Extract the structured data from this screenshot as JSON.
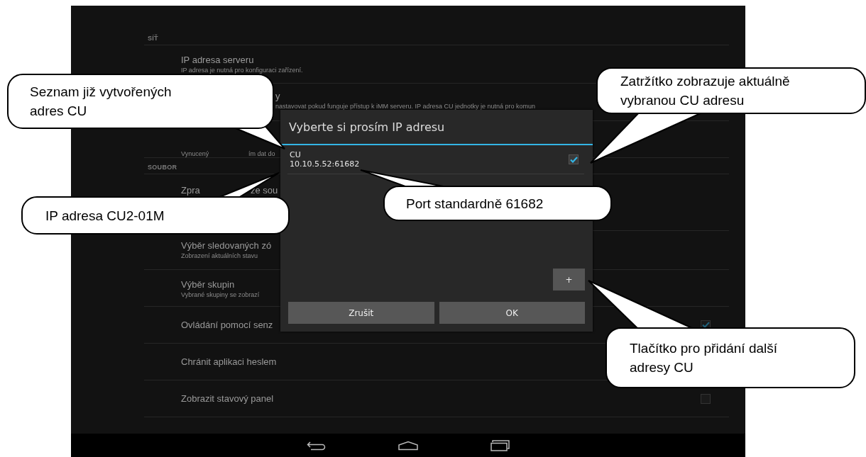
{
  "screen": {
    "sections": [
      {
        "title": "SÍŤ",
        "items": [
          {
            "title": [
              "IP adresa serveru"
            ],
            "subtitle": [
              "IP adresa je nutná pro konfiguraci zařízení."
            ]
          },
          {
            "title": [
              "y"
            ],
            "subtitle": [
              "nastavovat pokud funguje přístup k iMM serveru. IP adresa CU jednotky je nutná pro komun"
            ]
          },
          {
            "subtitle": [
              "Vynucený",
              "ím dat do"
            ]
          }
        ]
      },
      {
        "title": "SOUBOR",
        "items": [
          {
            "title": [
              "Zpra",
              "ze sou"
            ]
          },
          {
            "title": [
              "Výběr sledovaných zó"
            ],
            "subtitle": [
              "Zobrazení aktuálních stavu"
            ]
          },
          {
            "title": [
              "Výběr skupin"
            ],
            "subtitle": [
              "Vybrané skupiny se zobrazí"
            ]
          },
          {
            "title": [
              "Ovládání pomocí senz"
            ],
            "checked": true
          },
          {
            "title": [
              "Chránit aplikaci heslem"
            ]
          },
          {
            "title": [
              "Zobrazit stavový panel"
            ],
            "checked": false
          }
        ]
      }
    ]
  },
  "dialog": {
    "title": "Vyberte si prosím IP adresu",
    "items": [
      {
        "name": "CU",
        "address": "10.10.5.52:61682",
        "selected": true
      }
    ],
    "add_button": "+",
    "buttons": [
      "Zrušit",
      "OK"
    ]
  },
  "callouts": [
    {
      "text": "Seznam již vytvořených adres CU"
    },
    {
      "text": "IP adresa CU2-01M"
    },
    {
      "text": "Zatržítko zobrazuje aktuálně vybranou CU adresu"
    },
    {
      "text": "Port standardně 61682"
    },
    {
      "text": "Tlačítko pro přidání další adresy CU"
    }
  ]
}
